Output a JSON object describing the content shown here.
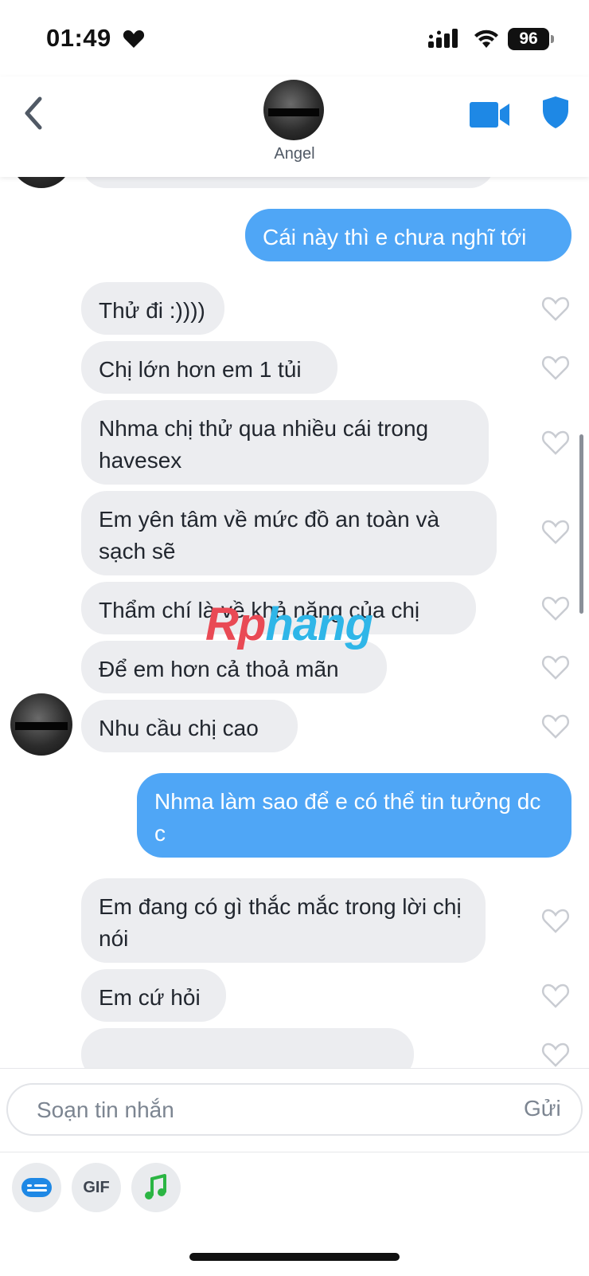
{
  "status_bar": {
    "time": "01:49",
    "battery": "96"
  },
  "header": {
    "contact_name": "Angel",
    "icons": [
      "back-chevron-icon",
      "video-camera-icon",
      "shield-icon"
    ]
  },
  "messages": [
    {
      "from": "me",
      "text": "Cái này thì e chưa nghĩ tới"
    },
    {
      "from": "them",
      "text": "Thử đi :))))"
    },
    {
      "from": "them",
      "text": "Chị lớn hơn em 1 tủi"
    },
    {
      "from": "them",
      "text": "Nhma chị thử qua nhiều cái trong havesex"
    },
    {
      "from": "them",
      "text": "Em yên tâm về mức đồ an toàn và sạch sẽ"
    },
    {
      "from": "them",
      "text": "Thẩm chí là về khả năng của chị"
    },
    {
      "from": "them",
      "text": "Để em hơn cả thoả mãn"
    },
    {
      "from": "them",
      "text": "Nhu cầu chị cao"
    },
    {
      "from": "me",
      "text": "Nhma làm sao để e có thể tin tưởng dc c"
    },
    {
      "from": "them",
      "text": "Em đang có gì thắc mắc trong lời chị nói"
    },
    {
      "from": "them",
      "text": "Em cứ hỏi"
    }
  ],
  "watermark": {
    "part1": "Rp",
    "part2": "hang"
  },
  "composer": {
    "placeholder": "Soạn tin nhắn",
    "send_label": "Gửi",
    "gif_label": "GIF"
  },
  "colors": {
    "outgoing_bubble": "#4fa6f6",
    "incoming_bubble": "#ecedf0",
    "accent": "#1e88e5",
    "like_outline": "#c9ccd2"
  }
}
